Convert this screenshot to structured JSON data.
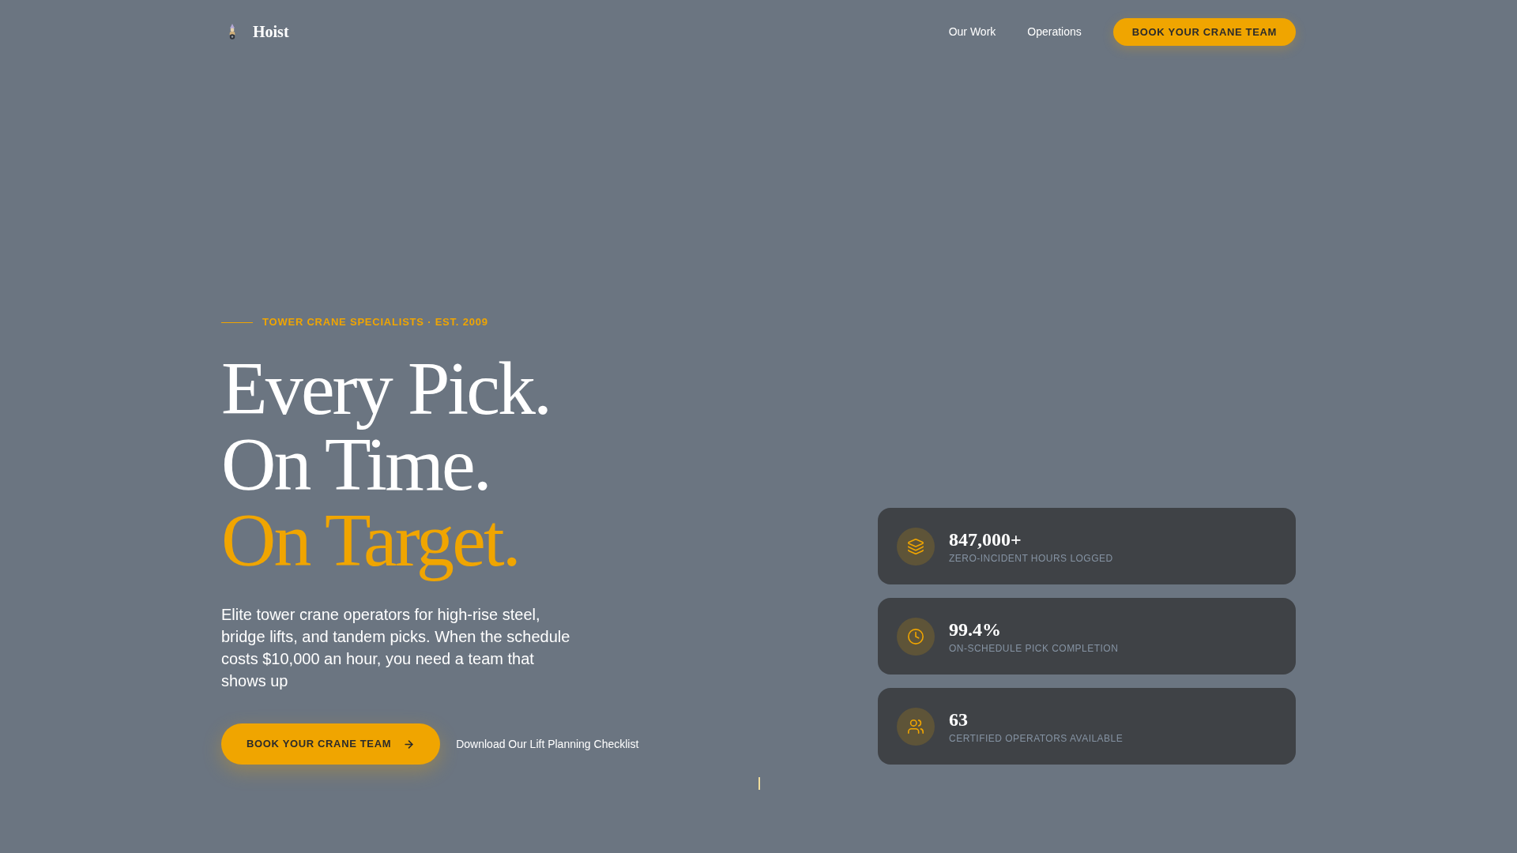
{
  "header": {
    "brand": "Hoist",
    "nav": [
      {
        "label": "Our Work"
      },
      {
        "label": "Operations"
      }
    ],
    "cta": "BOOK YOUR CRANE TEAM"
  },
  "hero": {
    "eyebrow": "TOWER CRANE SPECIALISTS · EST. 2009",
    "headline": [
      {
        "text": "Every Pick.",
        "highlighted": false
      },
      {
        "text": "On Time.",
        "highlighted": false
      },
      {
        "text": "On Target.",
        "highlighted": true
      }
    ],
    "description": "Elite tower crane operators for high-rise steel, bridge lifts, and tandem picks. When the schedule costs $10,000 an hour, you need a team that shows up",
    "primary_button": "BOOK YOUR CRANE TEAM",
    "secondary_link": "Download Our Lift Planning Checklist"
  },
  "stats": [
    {
      "value": "847,000+",
      "label": "ZERO-INCIDENT HOURS LOGGED"
    },
    {
      "value": "99.4%",
      "label": "ON-SCHEDULE PICK COMPLETION"
    },
    {
      "value": "63",
      "label": "CERTIFIED OPERATORS AVAILABLE"
    }
  ]
}
